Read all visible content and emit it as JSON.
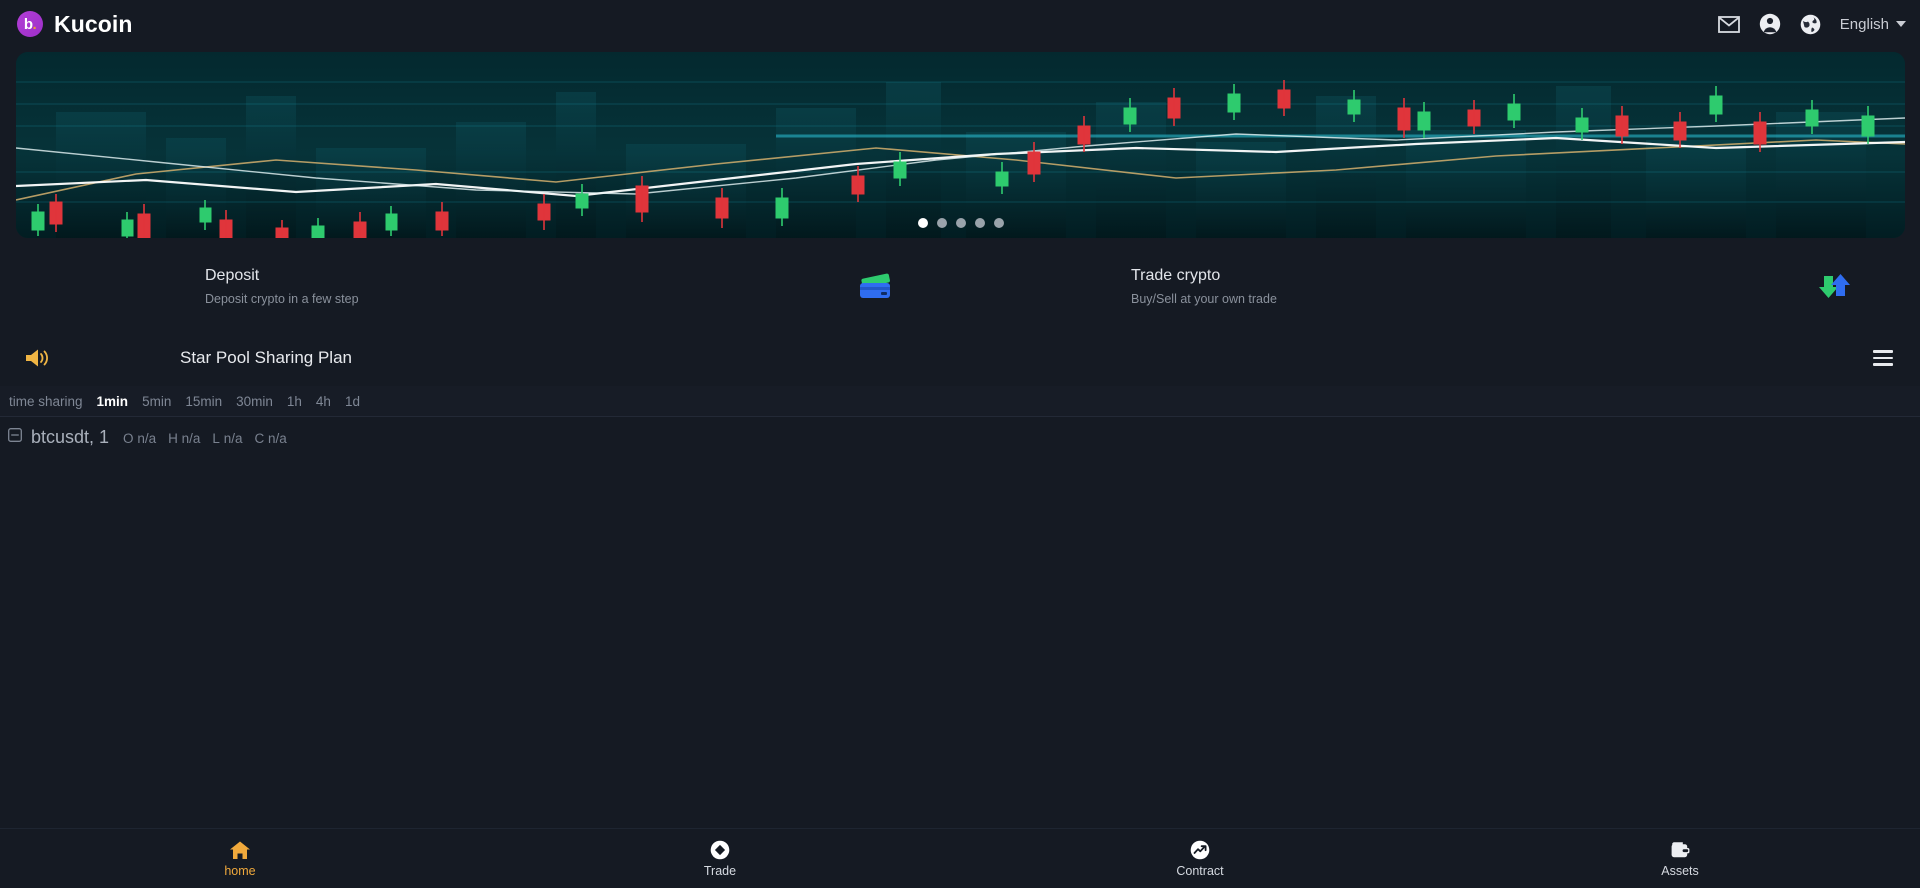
{
  "header": {
    "brand_mark": "b",
    "brand_dot": ".",
    "brand_name": "Kucoin",
    "mail_icon": "envelope-icon",
    "account_icon": "account-circle-icon",
    "globe_icon": "globe-icon",
    "language": "English",
    "language_caret": "chevron-down-icon"
  },
  "banner": {
    "alt": "crypto candlestick city skyline banner",
    "slide_count": 5,
    "active_slide": 1
  },
  "quick_actions": [
    {
      "title": "Deposit",
      "subtitle": "Deposit crypto in a few step",
      "icon": "credit-card-icon"
    },
    {
      "title": "Trade crypto",
      "subtitle": "Buy/Sell at your own trade",
      "icon": "exchange-arrows-icon"
    }
  ],
  "announcement": {
    "speaker_icon": "speaker-icon",
    "text": "Star Pool Sharing Plan",
    "menu_icon": "hamburger-menu-icon"
  },
  "timeframes": {
    "items": [
      {
        "label": "time sharing",
        "active": false
      },
      {
        "label": "1min",
        "active": true
      },
      {
        "label": "5min",
        "active": false
      },
      {
        "label": "15min",
        "active": false
      },
      {
        "label": "30min",
        "active": false
      },
      {
        "label": "1h",
        "active": false
      },
      {
        "label": "4h",
        "active": false
      },
      {
        "label": "1d",
        "active": false
      }
    ]
  },
  "chart": {
    "toggle_icon": "collapse-box-icon",
    "symbol": "btcusdt, 1",
    "open_label": "O",
    "open_value": "n/a",
    "high_label": "H",
    "high_value": "n/a",
    "low_label": "L",
    "low_value": "n/a",
    "close_label": "C",
    "close_value": "n/a"
  },
  "bottom_nav": [
    {
      "label": "home",
      "icon": "home-icon",
      "active": true
    },
    {
      "label": "Trade",
      "icon": "trade-diamond-icon",
      "active": false
    },
    {
      "label": "Contract",
      "icon": "trend-up-icon",
      "active": false
    },
    {
      "label": "Assets",
      "icon": "wallet-icon",
      "active": false
    }
  ],
  "colors": {
    "page_bg": "#151A23",
    "accent": "#f0a93c",
    "brand_purple": "#b23ed6",
    "text_primary": "#e8eaee",
    "text_muted": "#7f8795",
    "up_green": "#28c76f",
    "down_red": "#e0353b"
  }
}
